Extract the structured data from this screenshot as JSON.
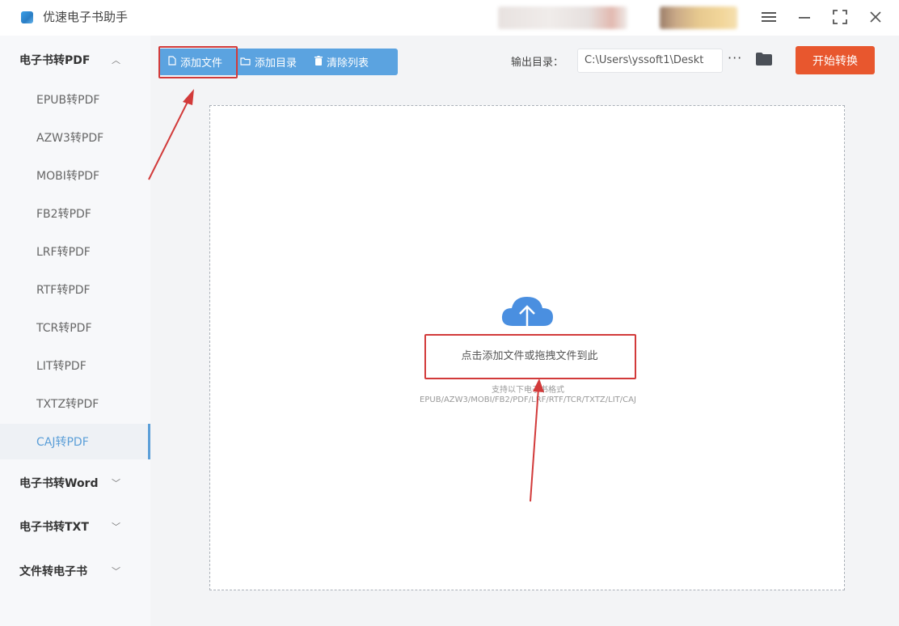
{
  "window": {
    "title": "优速电子书助手",
    "menu_icon": "menu-icon",
    "minimize_icon": "minimize-icon",
    "maximize_icon": "maximize-icon",
    "close_icon": "close-icon"
  },
  "sidebar": {
    "groups": [
      {
        "label": "电子书转PDF",
        "expanded": true,
        "items": [
          {
            "label": "EPUB转PDF"
          },
          {
            "label": "AZW3转PDF"
          },
          {
            "label": "MOBI转PDF"
          },
          {
            "label": "FB2转PDF"
          },
          {
            "label": "LRF转PDF"
          },
          {
            "label": "RTF转PDF"
          },
          {
            "label": "TCR转PDF"
          },
          {
            "label": "LIT转PDF"
          },
          {
            "label": "TXTZ转PDF"
          },
          {
            "label": "CAJ转PDF",
            "active": true
          }
        ]
      },
      {
        "label": "电子书转Word",
        "expanded": false
      },
      {
        "label": "电子书转TXT",
        "expanded": false
      },
      {
        "label": "文件转电子书",
        "expanded": false
      }
    ]
  },
  "toolbar": {
    "add_file": "添加文件",
    "add_folder": "添加目录",
    "clear_list": "清除列表",
    "output_label": "输出目录：",
    "output_path": "C:\\Users\\yssoft1\\Deskt",
    "more": "···",
    "start": "开始转换"
  },
  "dropzone": {
    "hint": "点击添加文件或拖拽文件到此",
    "support_label": "支持以下电子书格式",
    "formats": "EPUB/AZW3/MOBI/FB2/PDF/LRF/RTF/TCR/TXTZ/LIT/CAJ"
  },
  "colors": {
    "accent_blue": "#5ba3e0",
    "start_orange": "#e8572e",
    "annotation_red": "#d23a3a"
  }
}
